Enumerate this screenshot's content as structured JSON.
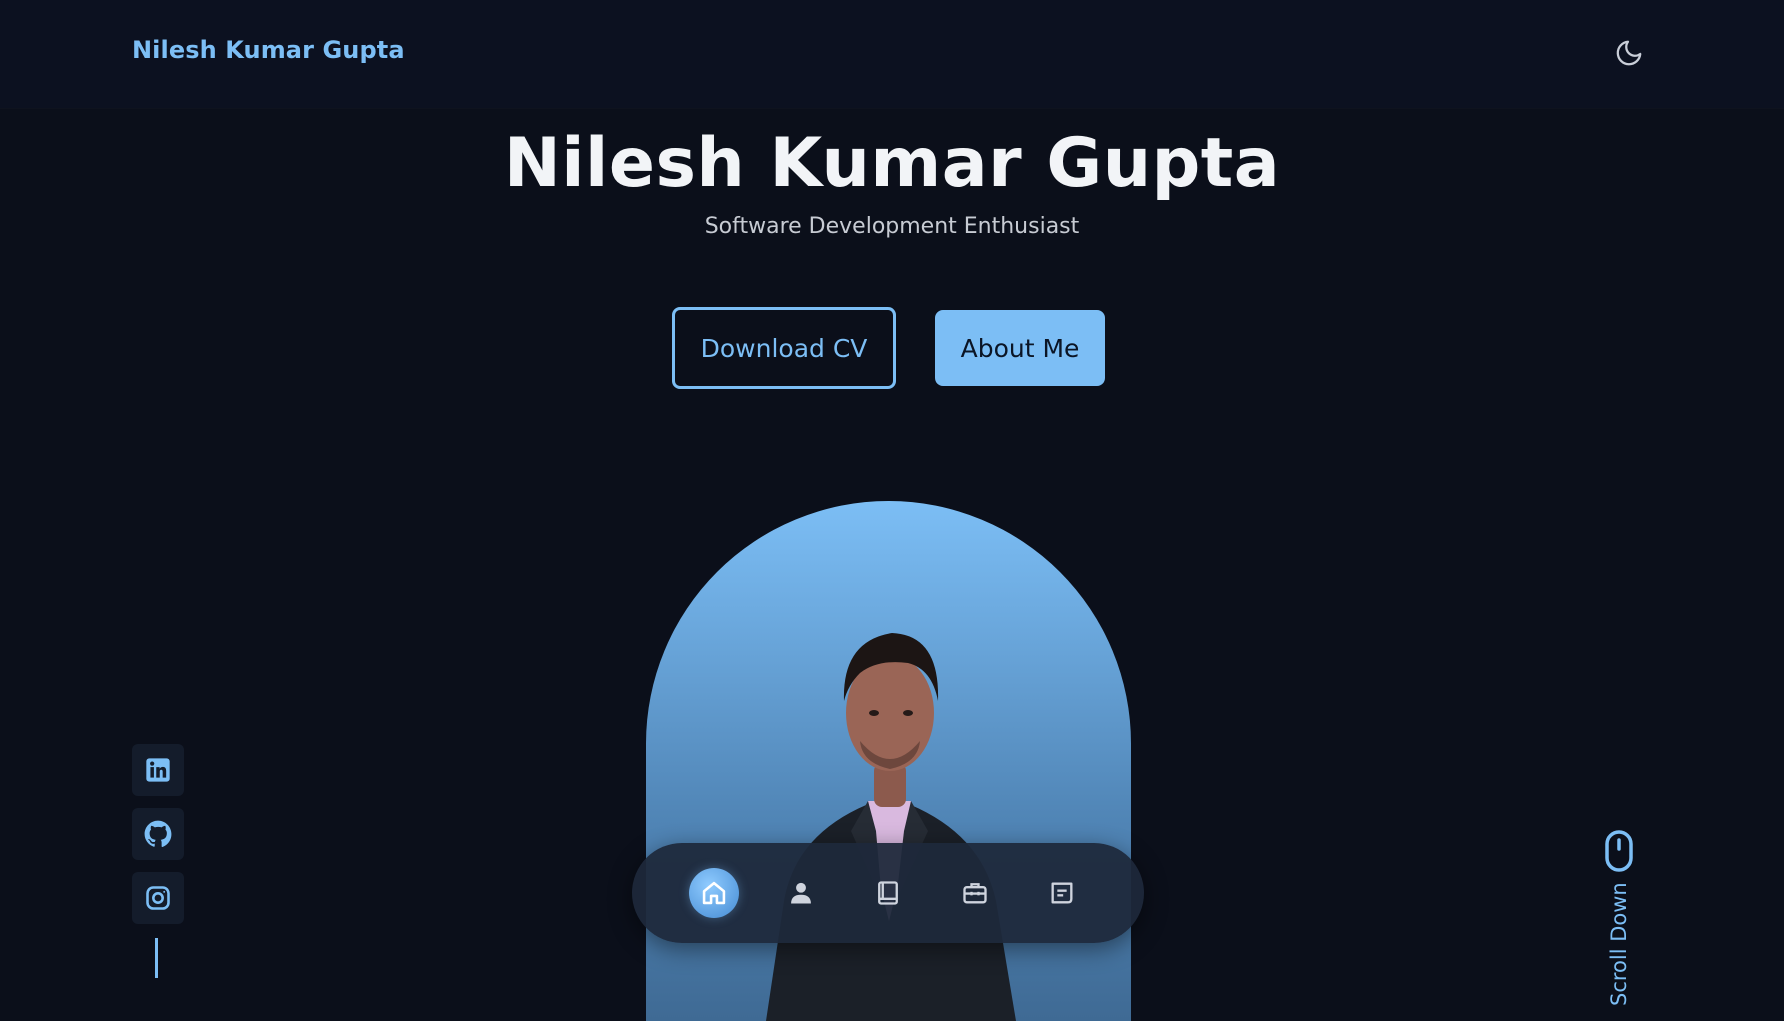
{
  "header": {
    "logo_text": "Nilesh Kumar Gupta",
    "theme_toggle_icon": "moon-icon"
  },
  "hero": {
    "title": "Nilesh Kumar Gupta",
    "subtitle": "Software Development Enthusiast",
    "download_cv_label": "Download CV",
    "about_me_label": "About Me",
    "portrait_image": "person-in-suit-portrait"
  },
  "social": {
    "items": [
      {
        "name": "linkedin",
        "icon": "linkedin-icon"
      },
      {
        "name": "github",
        "icon": "github-icon"
      },
      {
        "name": "instagram",
        "icon": "instagram-icon"
      }
    ]
  },
  "scroll": {
    "label": "Scroll Down",
    "icon": "mouse-icon"
  },
  "bottom_nav": {
    "items": [
      {
        "name": "home",
        "icon": "home-icon",
        "active": true
      },
      {
        "name": "about",
        "icon": "user-icon",
        "active": false
      },
      {
        "name": "qualification",
        "icon": "book-icon",
        "active": false
      },
      {
        "name": "projects",
        "icon": "briefcase-icon",
        "active": false
      },
      {
        "name": "contact",
        "icon": "message-icon",
        "active": false
      }
    ]
  },
  "colors": {
    "background": "#0b0f1a",
    "accent": "#7cbef5",
    "text": "#f2f4f7",
    "muted_text": "#c7cbd3",
    "surface": "#141c2b"
  }
}
